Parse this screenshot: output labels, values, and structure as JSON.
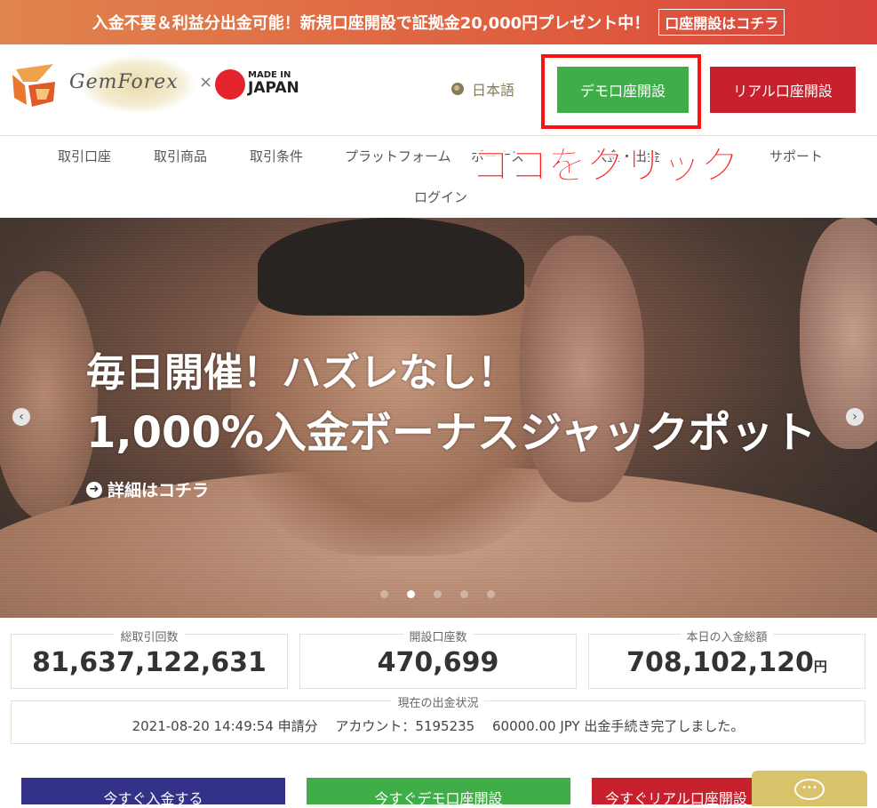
{
  "promo": {
    "text": "入金不要＆利益分出金可能！新規口座開設で証拠金20,000円プレゼント中！",
    "button": "口座開設はコチラ"
  },
  "header": {
    "logo_text": "GemForex",
    "logo_x": "×",
    "made_in": "MADE IN",
    "japan": "JAPAN",
    "language": "日本語",
    "demo_button": "デモ口座開設",
    "real_button": "リアル口座開設"
  },
  "nav": {
    "items": [
      "取引口座",
      "取引商品",
      "取引条件",
      "プラットフォーム",
      "ボーナス",
      "入金・出金",
      "サポート"
    ],
    "login": "ログイン",
    "annotation": "ココをクリック"
  },
  "hero": {
    "headline1": "毎日開催！ハズレなし！",
    "headline2": "1,000%入金ボーナスジャックポット",
    "link": "詳細はコチラ",
    "slide_count": 5,
    "active_slide": 2
  },
  "stats": {
    "total_trades_label": "総取引回数",
    "total_trades_value": "81,637,122,631",
    "accounts_label": "開設口座数",
    "accounts_value": "470,699",
    "deposit_label": "本日の入金総額",
    "deposit_value": "708,102,120",
    "deposit_unit": "円"
  },
  "status": {
    "label": "現在の出金状況",
    "text": "2021-08-20 14:49:54 申請分　 アカウント：5195235　 60000.00 JPY 出金手続き完了しました。"
  },
  "bottom_buttons": {
    "first": "今すぐ入金する",
    "second": "今すぐデモ口座開設",
    "third": "今すぐリアル口座開設"
  },
  "colors": {
    "demo_green": "#3fae49",
    "real_red": "#c8212e",
    "annotation_red": "#ff1b1b",
    "promo_orange": "#df5f3f",
    "chat_gold": "#d8c36b"
  }
}
